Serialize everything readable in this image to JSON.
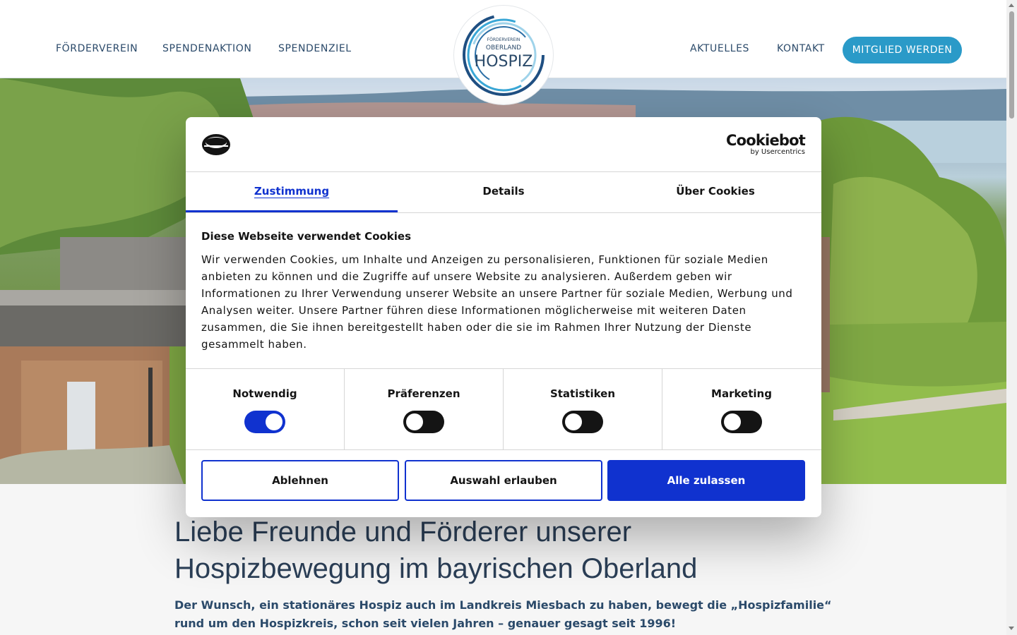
{
  "header": {
    "nav_left": [
      "FÖRDERVEREIN",
      "SPENDENAKTION",
      "SPENDENZIEL"
    ],
    "nav_right": [
      "AKTUELLES",
      "KONTAKT"
    ],
    "cta_label": "MITGLIED WERDEN",
    "logo": {
      "line1": "FÖRDERVEREIN",
      "line2": "OBERLAND",
      "line3": "HOSPIZ"
    }
  },
  "cookie_dialog": {
    "brand": {
      "name": "Cookiebot",
      "sub": "by Usercentrics"
    },
    "tabs": [
      "Zustimmung",
      "Details",
      "Über Cookies"
    ],
    "active_tab": "Zustimmung",
    "title": "Diese Webseite verwendet Cookies",
    "body": "Wir verwenden Cookies, um Inhalte und Anzeigen zu personalisieren, Funktionen für soziale Medien anbieten zu können und die Zugriffe auf unsere Website zu analysieren. Außerdem geben wir Informationen zu Ihrer Verwendung unserer Website an unsere Partner für soziale Medien, Werbung und Analysen weiter. Unsere Partner führen diese Informationen möglicherweise mit weiteren Daten zusammen, die Sie ihnen bereitgestellt haben oder die sie im Rahmen Ihrer Nutzung der Dienste gesammelt haben.",
    "toggles": [
      {
        "label": "Notwendig",
        "on": true
      },
      {
        "label": "Präferenzen",
        "on": false
      },
      {
        "label": "Statistiken",
        "on": false
      },
      {
        "label": "Marketing",
        "on": false
      }
    ],
    "buttons": {
      "decline": "Ablehnen",
      "allow_selection": "Auswahl erlauben",
      "allow_all": "Alle zulassen"
    }
  },
  "content": {
    "heading_line1": "Liebe Freunde und Förderer unserer",
    "heading_line2": "Hospizbewegung im bayrischen Oberland",
    "intro": "Der Wunsch, ein stationäres Hospiz auch im Landkreis Miesbach zu haben, bewegt die „Hospizfamilie“ rund um den Hospizkreis, schon seit vielen Jahren – genauer gesagt seit 1996!"
  },
  "colors": {
    "accent": "#2a9ac8",
    "cookiebot_blue": "#1032cf",
    "text_dark": "#2b3f57"
  }
}
